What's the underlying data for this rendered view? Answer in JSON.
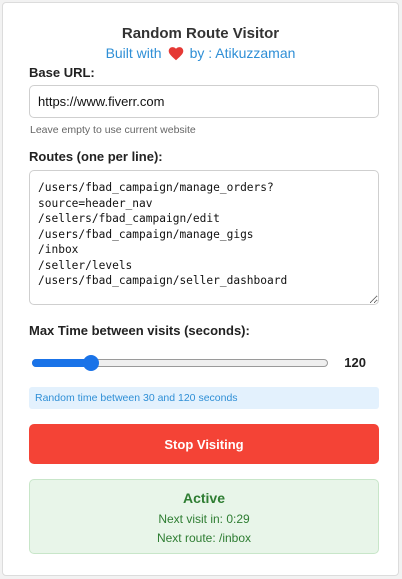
{
  "header": {
    "title": "Random Route Visitor",
    "built_with": "Built with",
    "by": "by : Atikuzzaman",
    "heart_icon": "heart-icon",
    "heart_color": "#e53935",
    "accent_color": "#2f8fd6"
  },
  "base_url": {
    "label": "Base URL:",
    "value": "https://www.fiverr.com",
    "hint": "Leave empty to use current website"
  },
  "routes": {
    "label": "Routes (one per line):",
    "value": "/users/fbad_campaign/manage_orders?\nsource=header_nav\n/sellers/fbad_campaign/edit\n/users/fbad_campaign/manage_gigs\n/inbox\n/seller/levels\n/users/fbad_campaign/seller_dashboard"
  },
  "max_time": {
    "label": "Max Time between visits (seconds):",
    "value": 120,
    "value_text": "120",
    "slider_fraction": 0.2,
    "info": "Random time between 30 and 120 seconds"
  },
  "action": {
    "stop_label": "Stop Visiting",
    "button_color": "#f44336"
  },
  "status": {
    "title": "Active",
    "next_visit": "Next visit in: 0:29",
    "next_route": "Next route: /inbox",
    "color": "#2e7d32"
  }
}
